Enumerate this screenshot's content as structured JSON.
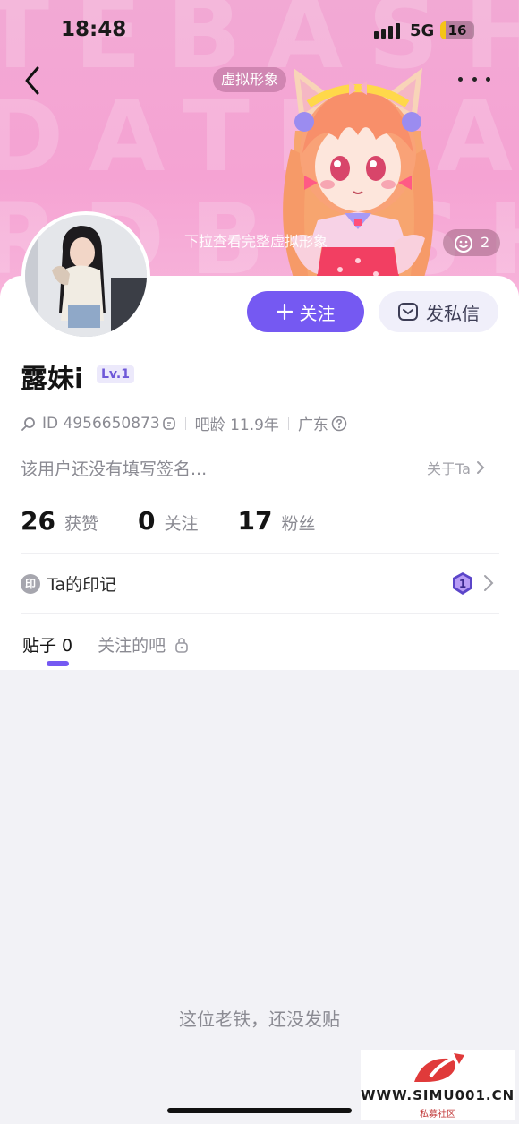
{
  "status_bar": {
    "time": "18:48",
    "network": "5G",
    "battery": "16",
    "battery_level": 0.16
  },
  "header": {
    "avatar_tag": "虚拟形象",
    "pull_hint": "下拉查看完整虚拟形象",
    "emoji_count": "2"
  },
  "profile": {
    "username": "露妹i",
    "level": "Lv.1",
    "id_text": "ID 4956650873",
    "bar_age": "吧龄 11.9年",
    "location": "广东",
    "signature": "该用户还没有填写签名...",
    "about_link": "关于Ta"
  },
  "actions": {
    "follow_label": "关注",
    "message_label": "发私信"
  },
  "stats": [
    {
      "value": "26",
      "label": "获赞"
    },
    {
      "value": "0",
      "label": "关注"
    },
    {
      "value": "17",
      "label": "粉丝"
    }
  ],
  "marks": {
    "icon_text": "印",
    "label": "Ta的印记",
    "badge_number": "1"
  },
  "tabs": {
    "posts": "贴子 0",
    "followed_bars": "关注的吧"
  },
  "empty_state": "这位老铁，还没发贴",
  "watermark": {
    "text": "WWW.SIMU001.CN",
    "sub": "私募社区"
  },
  "colors": {
    "accent": "#7559f2",
    "banner": "#f5a3d3",
    "battery": "#f5c518"
  },
  "icons": [
    "back-icon",
    "more-icon",
    "search-icon",
    "copy-icon",
    "help-icon",
    "chevron-right-icon",
    "plus-icon",
    "mail-icon",
    "lock-icon",
    "smile-icon",
    "mark-badge-icon"
  ]
}
